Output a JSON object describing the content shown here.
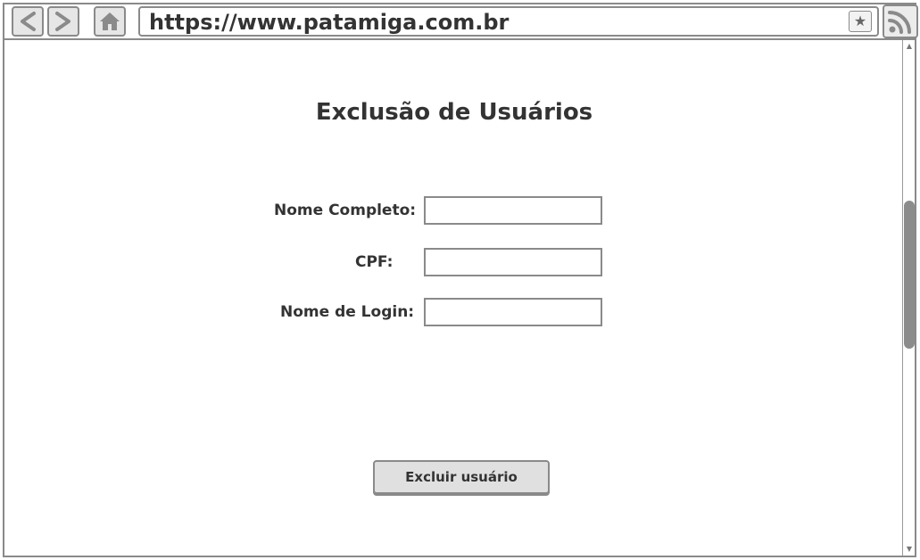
{
  "browser": {
    "url": "https://www.patamiga.com.br",
    "back_icon": "chevron-left-icon",
    "forward_icon": "chevron-right-icon",
    "home_icon": "home-icon",
    "bookmark_icon": "star-icon",
    "feed_icon": "rss-icon"
  },
  "page": {
    "title": "Exclusão de Usuários",
    "form": {
      "full_name_label": "Nome Completo:",
      "full_name_value": "",
      "cpf_label": "CPF:",
      "cpf_value": "",
      "login_label": "Nome de Login:",
      "login_value": "",
      "submit_label": "Excluir usuário"
    }
  },
  "colors": {
    "border": "#8a8a8a",
    "text": "#333333",
    "button_bg": "#e0e0e0",
    "scroll_thumb": "#8c8c8c"
  }
}
